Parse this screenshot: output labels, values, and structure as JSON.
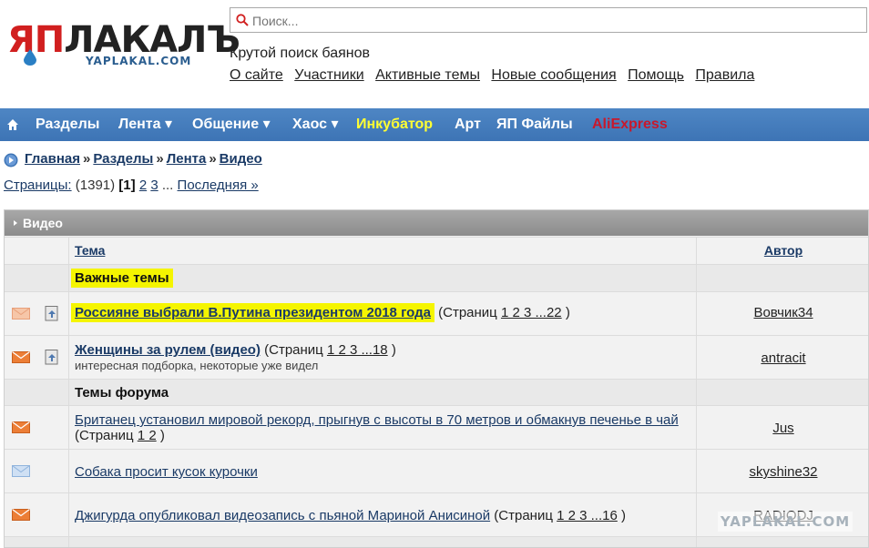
{
  "logo": {
    "main_ya": "ЯП",
    "main_rest": "ЛАКАЛЪ",
    "sub": "YAPLAKAL.COM"
  },
  "search": {
    "placeholder": "Поиск...",
    "value": ""
  },
  "tagline": "Крутой поиск баянов",
  "top_links": [
    "О сайте",
    "Участники",
    "Активные темы",
    "Новые сообщения",
    "Помощь",
    "Правила"
  ],
  "nav": {
    "items": [
      {
        "label": "Разделы",
        "style": "white"
      },
      {
        "label": "Лента ▾",
        "style": "white"
      },
      {
        "label": "Общение ▾",
        "style": "white"
      },
      {
        "label": "Хаос ▾",
        "style": "white"
      },
      {
        "label": "Инкубатор",
        "style": "yellow"
      },
      {
        "label": "Арт",
        "style": "white"
      },
      {
        "label": "ЯП Файлы",
        "style": "white"
      },
      {
        "label": "AliExpress",
        "style": "red"
      }
    ]
  },
  "breadcrumb": [
    "Главная",
    "Разделы",
    "Лента",
    "Видео"
  ],
  "breadcrumb_sep": "»",
  "pages": {
    "label": "Страницы:",
    "count": "(1391)",
    "current": "[1]",
    "p2": "2",
    "p3": "3",
    "dots": "...",
    "last": "Последняя »"
  },
  "forum": {
    "title": "Видео",
    "col_title": "Тема",
    "col_author": "Автор",
    "important_label": "Важные темы",
    "forum_label": "Темы форума",
    "pages_prefix": "(Страниц",
    "pages_suffix": ")",
    "topics": [
      {
        "title": "Россияне выбрали В.Путина президентом 2018 года",
        "pages": "1 2 3 ...22",
        "author": "Вовчик34",
        "desc": ""
      },
      {
        "title": "Женщины за рулем (видео)",
        "pages": "1 2 3 ...18",
        "author": "antracit",
        "desc": "интересная подборка, некоторые уже видел"
      },
      {
        "title": "Британец установил мировой рекорд, прыгнув с высоты в 70 метров и обмакнув печенье в чай",
        "pages": "1 2",
        "author": "Jus",
        "desc": ""
      },
      {
        "title": "Собака просит кусок курочки",
        "pages": "",
        "author": "skyshine32",
        "desc": ""
      },
      {
        "title": "Джигурда опубликовал видеозапись с пьяной Мариной Анисиной",
        "pages": "1 2 3 ...16",
        "author": "RADIODJ",
        "desc": ""
      }
    ]
  },
  "watermark": "YAPLAKAL.COM",
  "colors": {
    "nav_bg": "#4579bb",
    "link": "#1a3a66",
    "highlight": "#f5f500",
    "incubator": "#ffff33",
    "aliexpress": "#c8182c",
    "envelope": "#e8732a"
  }
}
